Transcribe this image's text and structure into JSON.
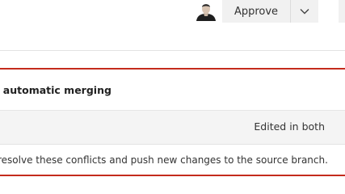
{
  "header": {
    "avatar_icon": "user-avatar",
    "approve_label": "Approve",
    "approve_dropdown_icon": "chevron-down-icon"
  },
  "conflicts": {
    "title": "s automatic merging",
    "file_status": "Edited in both",
    "instructions": " resolve these conflicts and push new changes to the source branch."
  },
  "colors": {
    "error_border": "#c42b1c",
    "button_bg": "#f1f1f1",
    "row_bg": "#f4f4f4"
  }
}
